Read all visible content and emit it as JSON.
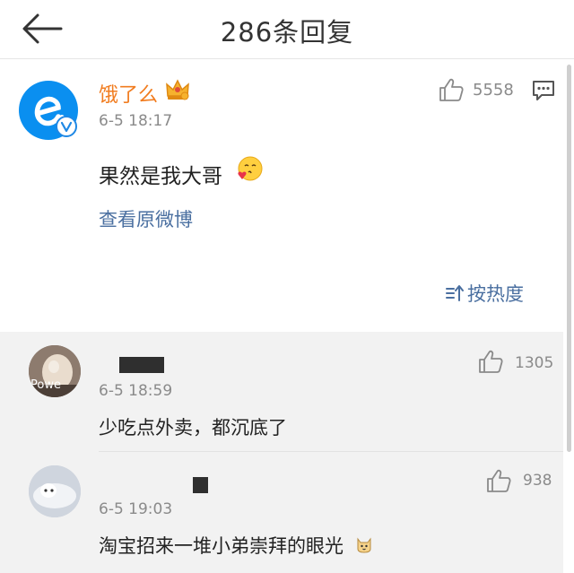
{
  "header": {
    "title": "286条回复",
    "back_icon": "arrow-left-icon"
  },
  "main_post": {
    "author": "饿了么",
    "author_color": "#f17c1f",
    "badge_icon": "crown-icon",
    "verify_icon": "verified-v-icon",
    "time": "6-5 18:17",
    "like_count": "5558",
    "text": "果然是我大哥",
    "emoji": "kiss-face-emoji",
    "view_original": "查看原微博",
    "sort_label": "按热度",
    "accent_color": "#4a6fa0"
  },
  "replies": [
    {
      "avatar_watermark": "Powe",
      "time": "6-5 18:59",
      "like_count": "1305",
      "text": "少吃点外卖，都沉底了"
    },
    {
      "time": "6-5 19:03",
      "like_count": "938",
      "text": "淘宝招来一堆小弟崇拜的眼光",
      "emoji": "cat-face-emoji"
    }
  ]
}
